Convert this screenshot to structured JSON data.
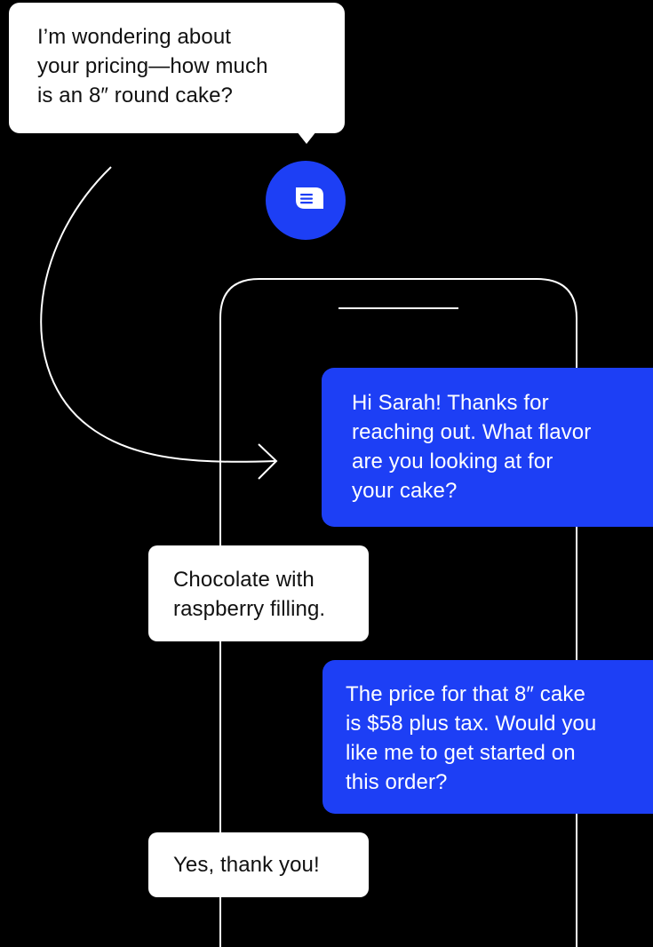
{
  "colors": {
    "background": "#000000",
    "accent_blue": "#1d3ff5",
    "bubble_white": "#ffffff",
    "outline": "#ffffff"
  },
  "icons": {
    "chat_badge": "chat-bubble-icon",
    "arrow": "curved-arrow-icon",
    "phone": "phone-outline-icon"
  },
  "incoming_message": "I’m wondering about your pricing—how much is an 8″ round cake?",
  "conversation": [
    {
      "sender": "business",
      "lines": [
        "Hi Sarah! Thanks for",
        "reaching out. What flavor",
        "are you looking at for",
        "your cake?"
      ]
    },
    {
      "sender": "customer",
      "lines": [
        "Chocolate with",
        "raspberry filling."
      ]
    },
    {
      "sender": "business",
      "lines": [
        "The price for that 8″ cake",
        "is $58 plus tax. Would you",
        "like me to get started on",
        "this order?"
      ]
    },
    {
      "sender": "customer",
      "lines": [
        "Yes, thank you!"
      ]
    }
  ],
  "incoming_lines": [
    "I’m wondering about",
    "your pricing—how much",
    "is an 8″ round cake?"
  ]
}
